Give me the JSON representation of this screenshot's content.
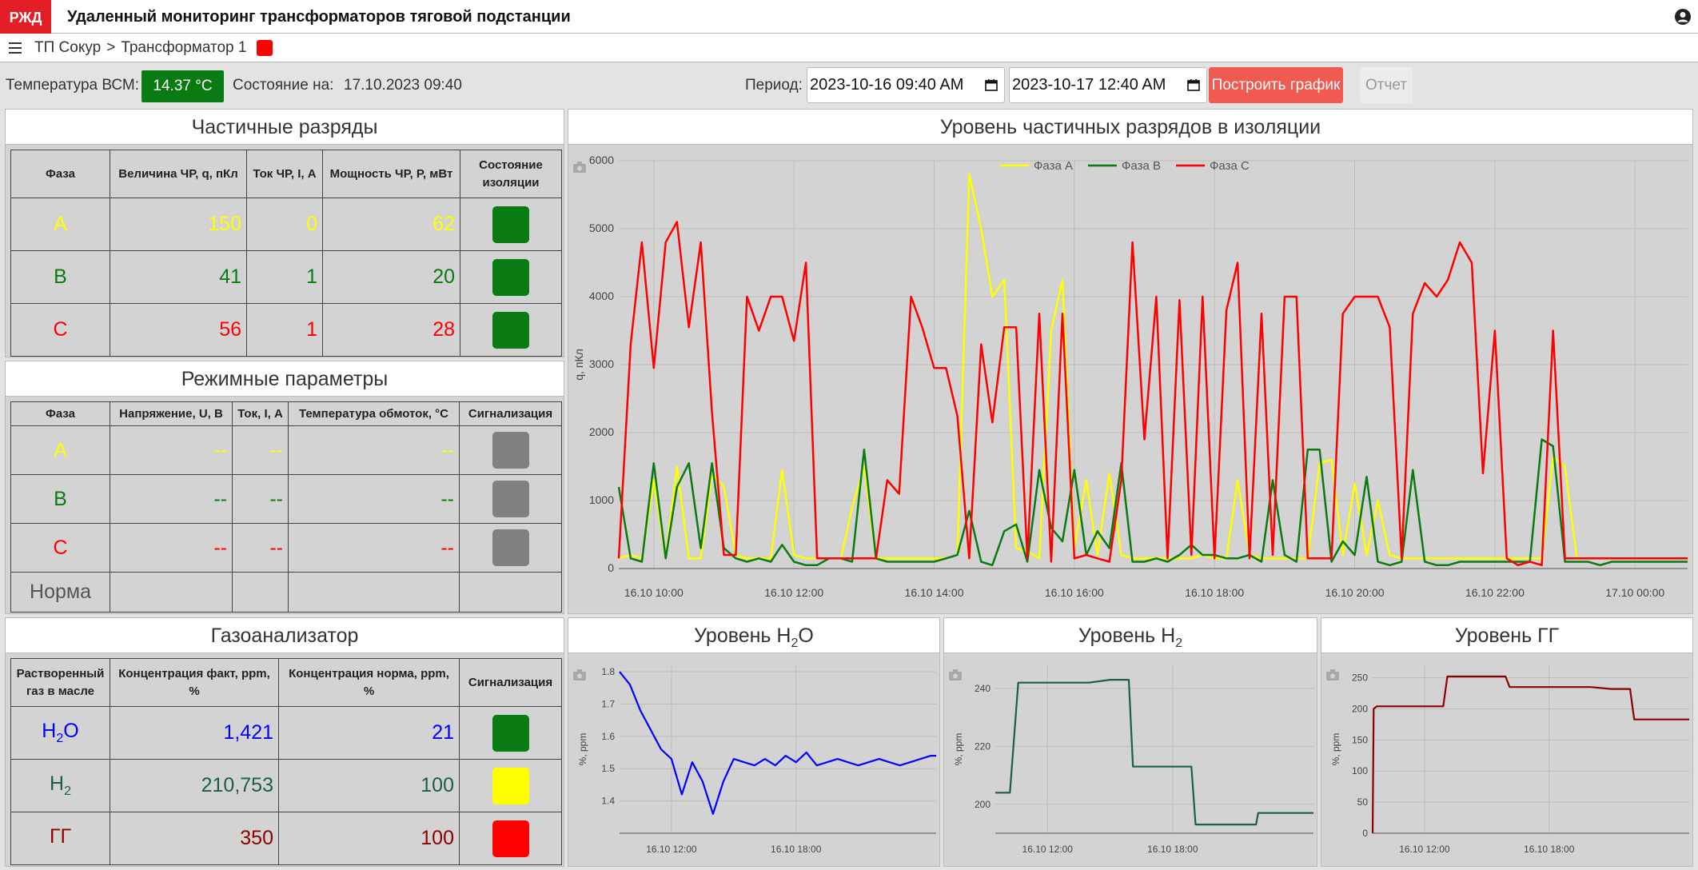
{
  "app": {
    "logo_text": "РЖД",
    "title": "Удаленный мониторинг трансформаторов тяговой подстанции"
  },
  "breadcrumb": {
    "root": "ТП Сокур",
    "separator": ">",
    "current": "Трансформатор 1",
    "status_color": "#ff0000"
  },
  "infobar": {
    "temp_label": "Температура ВСМ:",
    "temp_value": "14.37 °C",
    "state_label": "Состояние на:",
    "state_value": "17.10.2023 09:40",
    "period_label": "Период:",
    "period_from": "2023-10-16 09:40  AM",
    "period_to": "2023-10-17 12:40  AM",
    "plot_button": "Построить график",
    "report_button": "Отчет"
  },
  "pd_table": {
    "title": "Частичные разряды",
    "headers": [
      "Фаза",
      "Величина ЧР, q, пКл",
      "Ток ЧР, I, А",
      "Мощность ЧР, P, мВт",
      "Состояние изоляции"
    ],
    "rows": [
      {
        "phase": "A",
        "q": "150",
        "i": "0",
        "p": "62",
        "status_color": "#0a7b12"
      },
      {
        "phase": "B",
        "q": "41",
        "i": "1",
        "p": "20",
        "status_color": "#0a7b12"
      },
      {
        "phase": "C",
        "q": "56",
        "i": "1",
        "p": "28",
        "status_color": "#0a7b12"
      }
    ]
  },
  "mode_table": {
    "title": "Режимные параметры",
    "headers": [
      "Фаза",
      "Напряжение, U, В",
      "Ток, I, А",
      "Температура обмоток, °С",
      "Сигнализация"
    ],
    "rows": [
      {
        "phase": "A",
        "u": "--",
        "i": "--",
        "t": "--",
        "signal_color": "#808080"
      },
      {
        "phase": "B",
        "u": "--",
        "i": "--",
        "t": "--",
        "signal_color": "#808080"
      },
      {
        "phase": "C",
        "u": "--",
        "i": "--",
        "t": "--",
        "signal_color": "#808080"
      }
    ],
    "norm_label": "Норма"
  },
  "gas_table": {
    "title": "Газоанализатор",
    "headers": [
      "Растворенный газ в масле",
      "Концентрация факт, ppm, %",
      "Концентрация норма, ppm, %",
      "Сигнализация"
    ],
    "rows": [
      {
        "gas_main": "H",
        "gas_sub": "2",
        "gas_tail": "O",
        "fact": "1,421",
        "norm": "21",
        "signal_color": "#0a7b12"
      },
      {
        "gas_main": "H",
        "gas_sub": "2",
        "gas_tail": "",
        "fact": "210,753",
        "norm": "100",
        "signal_color": "#ffff00"
      },
      {
        "gas_main": "ГГ",
        "gas_sub": "",
        "gas_tail": "",
        "fact": "350",
        "norm": "100",
        "signal_color": "#ff0000"
      }
    ]
  },
  "charts": {
    "pd_title": "Уровень частичных разрядов в изоляции",
    "h2o_title": {
      "main": "Уровень H",
      "sub": "2",
      "tail": "O"
    },
    "h2_title": {
      "main": "Уровень H",
      "sub": "2",
      "tail": ""
    },
    "gg_title": "Уровень ГГ"
  },
  "chart_data": [
    {
      "type": "line",
      "title": "Уровень частичных разрядов в изоляции",
      "ylabel": "q, пКл",
      "xlabel": "",
      "ylim": [
        0,
        6000
      ],
      "xlim_hours": [
        9.5,
        24.75
      ],
      "grid": true,
      "legend_position": "top-center",
      "x_ticks": [
        "16.10 10:00",
        "16.10 12:00",
        "16.10 14:00",
        "16.10 16:00",
        "16.10 18:00",
        "16.10 20:00",
        "16.10 22:00",
        "17.10 00:00"
      ],
      "y_ticks": [
        0,
        1000,
        2000,
        3000,
        4000,
        5000,
        6000
      ],
      "series": [
        {
          "name": "Фаза A",
          "color": "#ffff00",
          "x": [
            9.5,
            9.67,
            9.83,
            10.0,
            10.17,
            10.33,
            10.5,
            10.67,
            10.83,
            11.0,
            11.17,
            11.33,
            11.5,
            11.67,
            11.83,
            12.0,
            12.17,
            12.33,
            12.5,
            12.67,
            12.83,
            13.0,
            13.17,
            13.33,
            13.5,
            13.67,
            13.83,
            14.0,
            14.17,
            14.33,
            14.5,
            14.67,
            14.83,
            15.0,
            15.17,
            15.33,
            15.5,
            15.67,
            15.83,
            16.0,
            16.17,
            16.33,
            16.5,
            16.67,
            16.83,
            17.0,
            17.17,
            17.33,
            17.5,
            17.67,
            17.83,
            18.0,
            18.17,
            18.33,
            18.5,
            18.67,
            18.83,
            19.0,
            19.17,
            19.33,
            19.5,
            19.67,
            19.83,
            20.0,
            20.17,
            20.33,
            20.5,
            20.67,
            20.83,
            21.0,
            21.17,
            21.33,
            21.5,
            21.67,
            21.83,
            22.0,
            22.17,
            22.33,
            22.5,
            22.67,
            22.83,
            23.0,
            23.17,
            23.33,
            23.5,
            23.67,
            23.83,
            24.0,
            24.17,
            24.33,
            24.5,
            24.75
          ],
          "y": [
            150,
            200,
            150,
            1300,
            150,
            1500,
            150,
            150,
            1400,
            1200,
            200,
            150,
            150,
            150,
            1450,
            200,
            150,
            150,
            150,
            150,
            900,
            1500,
            150,
            150,
            150,
            150,
            150,
            150,
            150,
            200,
            5800,
            5000,
            4000,
            4250,
            300,
            250,
            150,
            3500,
            4250,
            300,
            1300,
            200,
            1400,
            200,
            150,
            150,
            150,
            150,
            150,
            150,
            200,
            150,
            150,
            1300,
            200,
            150,
            150,
            150,
            150,
            150,
            1550,
            1600,
            200,
            1250,
            200,
            1000,
            200,
            150,
            150,
            150,
            150,
            150,
            150,
            150,
            150,
            150,
            150,
            150,
            150,
            150,
            1650,
            1500,
            150,
            150,
            150,
            150,
            150,
            150,
            150,
            150,
            150,
            150
          ]
        },
        {
          "name": "Фаза B",
          "color": "#0a7b12",
          "x": [
            9.5,
            9.67,
            9.83,
            10.0,
            10.17,
            10.33,
            10.5,
            10.67,
            10.83,
            11.0,
            11.17,
            11.33,
            11.5,
            11.67,
            11.83,
            12.0,
            12.17,
            12.33,
            12.5,
            12.67,
            12.83,
            13.0,
            13.17,
            13.33,
            13.5,
            13.67,
            13.83,
            14.0,
            14.17,
            14.33,
            14.5,
            14.67,
            14.83,
            15.0,
            15.17,
            15.33,
            15.5,
            15.67,
            15.83,
            16.0,
            16.17,
            16.33,
            16.5,
            16.67,
            16.83,
            17.0,
            17.17,
            17.33,
            17.5,
            17.67,
            17.83,
            18.0,
            18.17,
            18.33,
            18.5,
            18.67,
            18.83,
            19.0,
            19.17,
            19.33,
            19.5,
            19.67,
            19.83,
            20.0,
            20.17,
            20.33,
            20.5,
            20.67,
            20.83,
            21.0,
            21.17,
            21.33,
            21.5,
            21.67,
            21.83,
            22.0,
            22.17,
            22.33,
            22.5,
            22.67,
            22.83,
            23.0,
            23.17,
            23.33,
            23.5,
            23.67,
            23.83,
            24.0,
            24.17,
            24.33,
            24.5,
            24.75
          ],
          "y": [
            1200,
            150,
            100,
            1550,
            150,
            1200,
            1550,
            300,
            1550,
            300,
            150,
            100,
            150,
            100,
            350,
            100,
            50,
            50,
            150,
            150,
            100,
            1750,
            150,
            100,
            100,
            100,
            100,
            100,
            150,
            200,
            850,
            100,
            50,
            550,
            650,
            100,
            1450,
            600,
            400,
            1450,
            200,
            550,
            300,
            1550,
            100,
            100,
            150,
            100,
            200,
            350,
            200,
            200,
            150,
            150,
            200,
            100,
            1300,
            200,
            100,
            1750,
            1750,
            100,
            400,
            200,
            1350,
            100,
            50,
            100,
            1450,
            100,
            50,
            50,
            100,
            100,
            100,
            100,
            100,
            100,
            100,
            1900,
            1800,
            100,
            100,
            100,
            50,
            100,
            100,
            100,
            100,
            100,
            100,
            100
          ]
        },
        {
          "name": "Фаза C",
          "color": "#ff0000",
          "x": [
            9.5,
            9.67,
            9.83,
            10.0,
            10.17,
            10.33,
            10.5,
            10.67,
            10.83,
            11.0,
            11.17,
            11.33,
            11.5,
            11.67,
            11.83,
            12.0,
            12.17,
            12.33,
            12.5,
            12.67,
            12.83,
            13.0,
            13.17,
            13.33,
            13.5,
            13.67,
            13.83,
            14.0,
            14.17,
            14.33,
            14.5,
            14.67,
            14.83,
            15.0,
            15.17,
            15.33,
            15.5,
            15.67,
            15.83,
            16.0,
            16.17,
            16.33,
            16.5,
            16.67,
            16.83,
            17.0,
            17.17,
            17.33,
            17.5,
            17.67,
            17.83,
            18.0,
            18.17,
            18.33,
            18.5,
            18.67,
            18.83,
            19.0,
            19.17,
            19.33,
            19.5,
            19.67,
            19.83,
            20.0,
            20.17,
            20.33,
            20.5,
            20.67,
            20.83,
            21.0,
            21.17,
            21.33,
            21.5,
            21.67,
            21.83,
            22.0,
            22.17,
            22.33,
            22.5,
            22.67,
            22.83,
            23.0,
            23.17,
            23.33,
            23.5,
            23.67,
            23.83,
            24.0,
            24.17,
            24.33,
            24.5,
            24.75
          ],
          "y": [
            150,
            3300,
            4800,
            2950,
            4800,
            5100,
            3550,
            4800,
            2300,
            200,
            200,
            4000,
            3500,
            4000,
            4000,
            3350,
            4500,
            150,
            150,
            150,
            150,
            150,
            150,
            1300,
            1100,
            4000,
            3550,
            2950,
            2950,
            2250,
            150,
            3300,
            2150,
            3550,
            3550,
            150,
            3750,
            100,
            3750,
            150,
            200,
            150,
            100,
            1300,
            4800,
            1900,
            4000,
            150,
            3950,
            200,
            4000,
            150,
            3800,
            4500,
            150,
            3750,
            200,
            4000,
            4000,
            150,
            150,
            150,
            3750,
            4000,
            4000,
            4000,
            3550,
            150,
            3750,
            4200,
            4000,
            4250,
            4800,
            4500,
            1400,
            3500,
            150,
            50,
            100,
            50,
            3500,
            150,
            150,
            150,
            150,
            150,
            150,
            150,
            150,
            150,
            150,
            150
          ]
        }
      ]
    },
    {
      "type": "line",
      "title": "Уровень H2O",
      "ylabel": "%, ppm",
      "ylim": [
        1.3,
        1.82
      ],
      "xlim_hours": [
        9.5,
        24.75
      ],
      "grid": true,
      "x_ticks": [
        "16.10 12:00",
        "16.10 18:00"
      ],
      "y_ticks": [
        1.4,
        1.5,
        1.6,
        1.7,
        1.8
      ],
      "series": [
        {
          "name": "",
          "color": "#0000ff",
          "x": [
            9.5,
            10.0,
            10.5,
            11.0,
            11.5,
            12.0,
            12.5,
            13.0,
            13.5,
            14.0,
            14.5,
            15.0,
            15.5,
            16.0,
            16.5,
            17.0,
            17.5,
            18.0,
            18.5,
            19.0,
            19.5,
            20.0,
            20.5,
            21.0,
            21.5,
            22.0,
            22.5,
            23.0,
            23.5,
            24.0,
            24.5,
            24.75
          ],
          "y": [
            1.8,
            1.76,
            1.68,
            1.62,
            1.56,
            1.53,
            1.42,
            1.52,
            1.46,
            1.36,
            1.46,
            1.53,
            1.52,
            1.51,
            1.53,
            1.51,
            1.54,
            1.52,
            1.55,
            1.51,
            1.52,
            1.53,
            1.52,
            1.51,
            1.52,
            1.53,
            1.52,
            1.51,
            1.52,
            1.53,
            1.54,
            1.54
          ]
        }
      ]
    },
    {
      "type": "line",
      "title": "Уровень H2",
      "ylabel": "%, ppm",
      "ylim": [
        190,
        248
      ],
      "xlim_hours": [
        9.5,
        24.75
      ],
      "grid": true,
      "x_ticks": [
        "16.10 12:00",
        "16.10 18:00"
      ],
      "y_ticks": [
        200,
        220,
        240
      ],
      "series": [
        {
          "name": "",
          "color": "#1b5e4a",
          "x": [
            9.5,
            10.2,
            10.6,
            11.0,
            12.0,
            13.0,
            14.0,
            15.0,
            15.9,
            16.1,
            17.0,
            18.0,
            18.9,
            19.1,
            20.0,
            21.0,
            22.0,
            22.1,
            23.0,
            24.0,
            24.75
          ],
          "y": [
            204,
            204,
            242,
            242,
            242,
            242,
            242,
            243,
            243,
            213,
            213,
            213,
            213,
            193,
            193,
            193,
            193,
            197,
            197,
            197,
            197
          ]
        }
      ]
    },
    {
      "type": "line",
      "title": "Уровень ГГ",
      "ylabel": "%, ppm",
      "ylim": [
        0,
        270
      ],
      "xlim_hours": [
        9.5,
        24.75
      ],
      "grid": true,
      "x_ticks": [
        "16.10 12:00",
        "16.10 18:00"
      ],
      "y_ticks": [
        0,
        50,
        100,
        150,
        200,
        250
      ],
      "series": [
        {
          "name": "",
          "color": "#8b0000",
          "x": [
            9.5,
            9.55,
            9.7,
            12.0,
            12.9,
            13.1,
            15.9,
            16.1,
            20.0,
            21.0,
            21.9,
            22.1,
            24.0,
            24.75
          ],
          "y": [
            0,
            200,
            204,
            204,
            204,
            252,
            252,
            235,
            235,
            232,
            232,
            183,
            183,
            183
          ]
        }
      ]
    }
  ]
}
